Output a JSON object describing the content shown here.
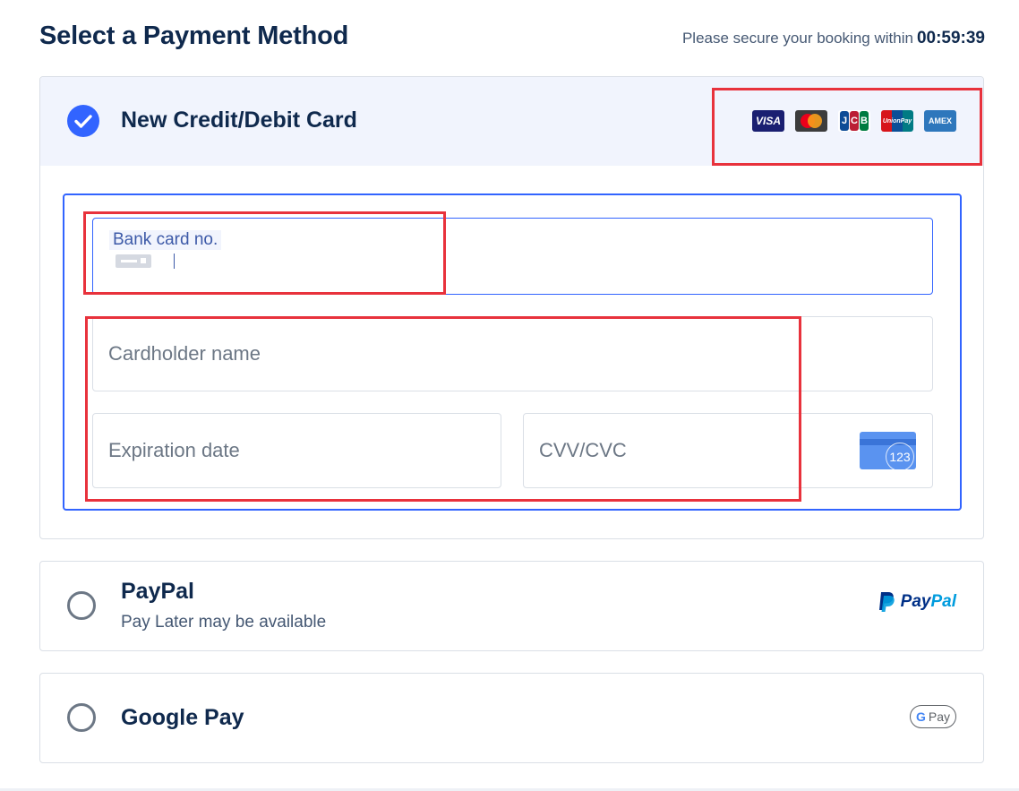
{
  "page": {
    "title": "Select a Payment Method",
    "timer_label": "Please secure your booking within",
    "timer_value": "00:59:39"
  },
  "card_method": {
    "title": "New Credit/Debit Card",
    "selected": true,
    "brands": [
      {
        "name": "visa-logo",
        "label": "VISA"
      },
      {
        "name": "mastercard-logo",
        "label": ""
      },
      {
        "name": "jcb-logo",
        "label": "JCB"
      },
      {
        "name": "unionpay-logo",
        "label": "UnionPay"
      },
      {
        "name": "amex-logo",
        "label": "AMEX"
      }
    ],
    "fields": {
      "card_number_label": "Bank card no.",
      "cardholder_placeholder": "Cardholder name",
      "expiration_placeholder": "Expiration date",
      "cvv_placeholder": "CVV/CVC",
      "cvv_icon_text": "123"
    }
  },
  "paypal": {
    "title": "PayPal",
    "subtitle": "Pay Later may be available",
    "logo_text_1": "Pay",
    "logo_text_2": "Pal"
  },
  "google_pay": {
    "title": "Google Pay",
    "logo_g": "G",
    "logo_text": "Pay"
  },
  "colors": {
    "accent": "#3264ff",
    "annotation_red": "#e8323c",
    "text_primary": "#0f294d"
  }
}
